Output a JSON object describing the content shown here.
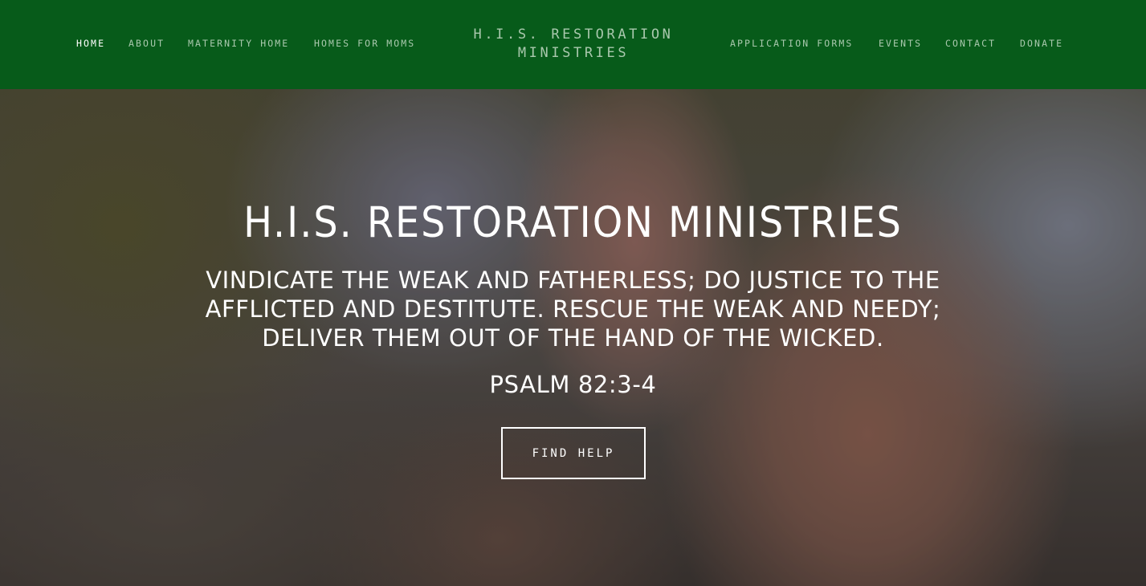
{
  "header": {
    "site_title": "H.I.S. RESTORATION MINISTRIES",
    "nav_left": [
      {
        "label": "HOME",
        "active": true
      },
      {
        "label": "ABOUT",
        "active": false
      },
      {
        "label": "MATERNITY HOME",
        "active": false
      },
      {
        "label": "HOMES FOR MOMS",
        "active": false
      }
    ],
    "nav_right": [
      {
        "label": "APPLICATION FORMS",
        "active": false
      },
      {
        "label": "EVENTS",
        "active": false
      },
      {
        "label": "CONTACT",
        "active": false
      },
      {
        "label": "DONATE",
        "active": false
      }
    ]
  },
  "hero": {
    "title": "H.I.S. RESTORATION MINISTRIES",
    "verse": "VINDICATE THE WEAK AND FATHERLESS; DO JUSTICE TO THE AFFLICTED AND DESTITUTE. RESCUE THE WEAK AND NEEDY; DELIVER THEM OUT OF THE HAND OF THE WICKED.",
    "reference": "PSALM 82:3-4",
    "cta_label": "FIND HELP"
  },
  "colors": {
    "header_bg": "#075b1a",
    "nav_text": "#a9c8ad",
    "nav_active": "#ffffff",
    "hero_text": "#ffffff"
  }
}
